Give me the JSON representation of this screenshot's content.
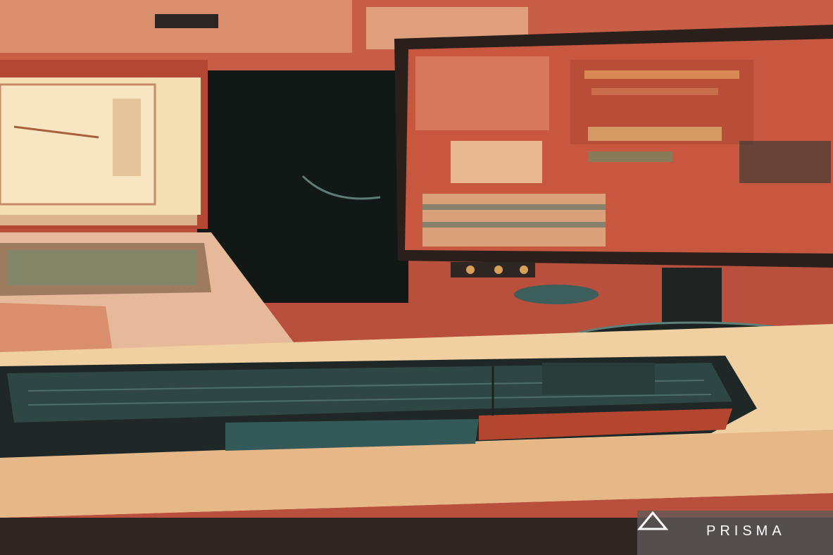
{
  "image": {
    "style": "painted filter",
    "palette": {
      "wall": "#c9573f",
      "cream": "#f3d8ad",
      "teal": "#2c5a58",
      "dark": "#1c2220",
      "screen_red": "#c85a45",
      "desk": "#f0cfa0"
    }
  },
  "watermark": {
    "text": "PRISMA",
    "icon": "triangle-logo-icon"
  }
}
